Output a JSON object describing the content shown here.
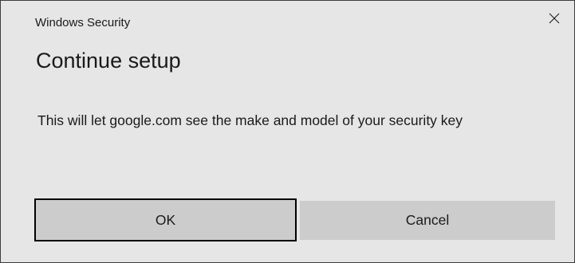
{
  "window": {
    "caption": "Windows Security",
    "close_icon": "close-icon"
  },
  "dialog": {
    "title": "Continue setup",
    "message": "This will let google.com see the make and model of your security key"
  },
  "buttons": {
    "ok_label": "OK",
    "cancel_label": "Cancel"
  },
  "colors": {
    "dialog_background": "#e6e6e6",
    "button_background": "#cccccc",
    "focus_border": "#000000",
    "text": "#1a1a1a"
  }
}
